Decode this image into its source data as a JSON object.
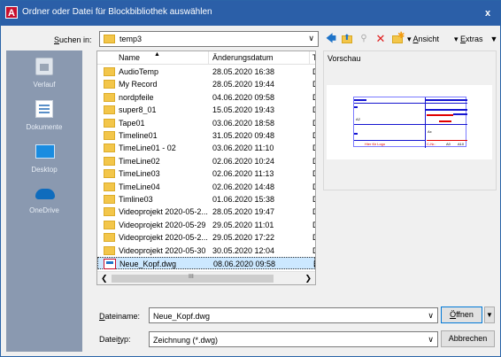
{
  "window": {
    "title": "Ordner oder Datei für Blockbibliothek auswählen",
    "close_label": "x",
    "app_logo_letter": "A"
  },
  "lookin": {
    "label": "Suchen in:",
    "value": "temp3"
  },
  "toolbar": {
    "view_label": "Ansicht",
    "extras_label": "Extras"
  },
  "places": [
    {
      "label": "Verlauf",
      "icon": "history-icon"
    },
    {
      "label": "Dokumente",
      "icon": "documents-icon"
    },
    {
      "label": "Desktop",
      "icon": "desktop-icon"
    },
    {
      "label": "OneDrive",
      "icon": "onedrive-icon"
    }
  ],
  "filelist": {
    "columns": [
      "Name",
      "Änderungsdatum",
      "T"
    ],
    "rows": [
      {
        "name": "AudioTemp",
        "date": "28.05.2020 16:38",
        "type": "D",
        "kind": "folder"
      },
      {
        "name": "My Record",
        "date": "28.05.2020 19:44",
        "type": "D",
        "kind": "folder"
      },
      {
        "name": "nordpfeile",
        "date": "04.06.2020 09:58",
        "type": "D",
        "kind": "folder"
      },
      {
        "name": "super8_01",
        "date": "15.05.2020 19:43",
        "type": "D",
        "kind": "folder"
      },
      {
        "name": "Tape01",
        "date": "03.06.2020 18:58",
        "type": "D",
        "kind": "folder"
      },
      {
        "name": "Timeline01",
        "date": "31.05.2020 09:48",
        "type": "D",
        "kind": "folder"
      },
      {
        "name": "TimeLine01 - 02",
        "date": "03.06.2020 11:10",
        "type": "D",
        "kind": "folder"
      },
      {
        "name": "TimeLine02",
        "date": "02.06.2020 10:24",
        "type": "D",
        "kind": "folder"
      },
      {
        "name": "TimeLine03",
        "date": "02.06.2020 11:13",
        "type": "D",
        "kind": "folder"
      },
      {
        "name": "TimeLine04",
        "date": "02.06.2020 14:48",
        "type": "D",
        "kind": "folder"
      },
      {
        "name": "Timline03",
        "date": "01.06.2020 15:38",
        "type": "D",
        "kind": "folder"
      },
      {
        "name": "Videoprojekt 2020-05-2...",
        "date": "28.05.2020 19:47",
        "type": "D",
        "kind": "folder"
      },
      {
        "name": "Videoprojekt 2020-05-29",
        "date": "29.05.2020 11:01",
        "type": "D",
        "kind": "folder"
      },
      {
        "name": "Videoprojekt 2020-05-2...",
        "date": "29.05.2020 17:22",
        "type": "D",
        "kind": "folder"
      },
      {
        "name": "Videoprojekt 2020-05-30",
        "date": "30.05.2020 12:04",
        "type": "D",
        "kind": "folder"
      },
      {
        "name": "Neue_Kopf.dwg",
        "date": "08.06.2020 09:58",
        "type": "D",
        "kind": "dwg"
      }
    ],
    "scroll_grip": "III"
  },
  "preview": {
    "label": "Vorschau",
    "text_a2": "A2",
    "text_logo": "Hier für Logo",
    "text_ax": "Ax",
    "text_cnr": "C-Nr.:",
    "text_a0": "A0",
    "text_a10": "A10"
  },
  "filename": {
    "label": "Dateiname:",
    "value": "Neue_Kopf.dwg"
  },
  "filetype": {
    "label": "Dateityp:",
    "value": "Zeichnung (*.dwg)"
  },
  "buttons": {
    "open": "Öffnen",
    "cancel": "Abbrechen"
  }
}
